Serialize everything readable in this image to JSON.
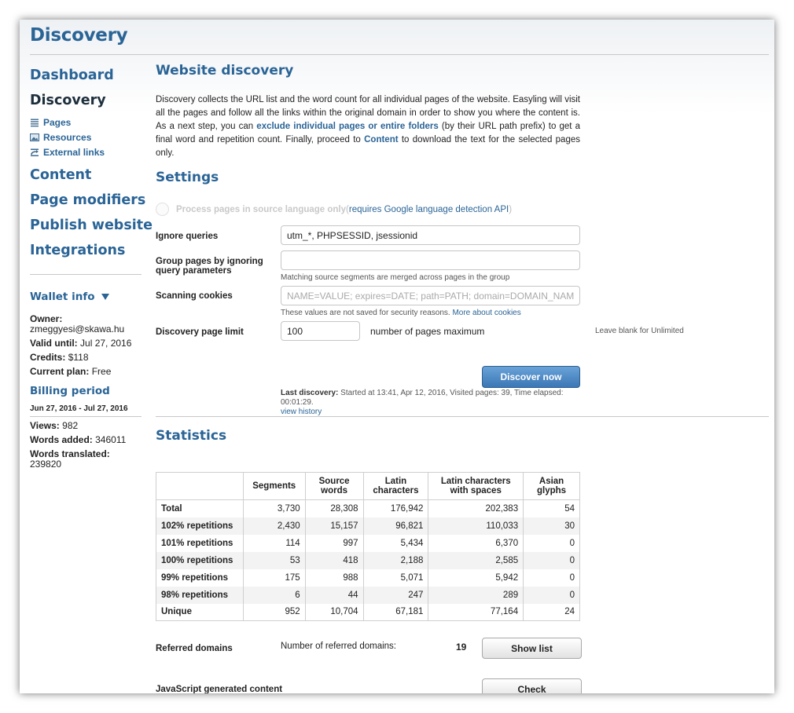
{
  "app": {
    "title": "Discovery"
  },
  "sidebar": {
    "nav": [
      {
        "label": "Dashboard"
      },
      {
        "label": "Discovery"
      }
    ],
    "subnav": [
      {
        "label": "Pages",
        "icon": "list-icon"
      },
      {
        "label": "Resources",
        "icon": "image-icon"
      },
      {
        "label": "External links",
        "icon": "link-icon"
      }
    ],
    "nav2": [
      {
        "label": "Content"
      },
      {
        "label": "Page modifiers"
      },
      {
        "label": "Publish website"
      },
      {
        "label": "Integrations"
      }
    ],
    "wallet": {
      "title": "Wallet info",
      "owner_label": "Owner:",
      "owner_value": "zmeggyesi@skawa.hu",
      "valid_label": "Valid until:",
      "valid_value": "Jul 27, 2016",
      "credits_label": "Credits:",
      "credits_value": "$118",
      "plan_label": "Current plan:",
      "plan_value": "Free"
    },
    "billing": {
      "title": "Billing period",
      "dates": "Jun 27, 2016 - Jul 27, 2016",
      "views_label": "Views:",
      "views_value": "982",
      "words_added_label": "Words added:",
      "words_added_value": "346011",
      "words_translated_label": "Words translated:",
      "words_translated_value": "239820"
    }
  },
  "main": {
    "title": "Website discovery",
    "intro": {
      "p1": "Discovery collects the URL list and the word count for all individual pages of the website. Easyling will visit all the pages and follow all the links within the original domain in order to show you where the content is. As a next step, you can ",
      "link1": "exclude individual pages or entire folders",
      "p2": " (by their URL path prefix) to get a final word and repetition count. Finally, proceed to ",
      "link2": "Content",
      "p3": " to download the text for the selected pages only."
    },
    "settings": {
      "title": "Settings",
      "process_label": "Process pages in source language only",
      "process_paren_open": " (",
      "process_link": "requires Google language detection API",
      "process_paren_close": ")",
      "ignore_queries_label": "Ignore queries",
      "ignore_queries_value": "utm_*, PHPSESSID, jsessionid",
      "group_label_1": "Group pages by ignoring",
      "group_label_2": "query parameters",
      "group_value": "",
      "group_hint": "Matching source segments are merged across pages in the group",
      "cookies_label": "Scanning cookies",
      "cookies_placeholder": "NAME=VALUE; expires=DATE; path=PATH; domain=DOMAIN_NAME; secure",
      "cookies_hint": "These values are not saved for security reasons. ",
      "cookies_hint_link": "More about cookies",
      "limit_label": "Discovery page limit",
      "limit_value": "100",
      "limit_suffix": "number of pages maximum",
      "limit_note": "Leave blank for Unlimited",
      "discover_button": "Discover now",
      "last_discovery_label": "Last discovery:",
      "last_discovery_text": " Started at 13:41, Apr 12, 2016, Visited pages: 39, Time elapsed: 00:01:29.",
      "view_history": "view history"
    },
    "statistics": {
      "title": "Statistics",
      "headers": [
        "",
        "Segments",
        "Source words",
        "Latin characters",
        "Latin characters with spaces",
        "Asian glyphs"
      ],
      "rows": [
        [
          "Total",
          "3,730",
          "28,308",
          "176,942",
          "202,383",
          "54"
        ],
        [
          "102% repetitions",
          "2,430",
          "15,157",
          "96,821",
          "110,033",
          "30"
        ],
        [
          "101% repetitions",
          "114",
          "997",
          "5,434",
          "6,370",
          "0"
        ],
        [
          "100% repetitions",
          "53",
          "418",
          "2,188",
          "2,585",
          "0"
        ],
        [
          "99% repetitions",
          "175",
          "988",
          "5,071",
          "5,942",
          "0"
        ],
        [
          "98% repetitions",
          "6",
          "44",
          "247",
          "289",
          "0"
        ],
        [
          "Unique",
          "952",
          "10,704",
          "67,181",
          "77,164",
          "24"
        ]
      ]
    },
    "referred": {
      "label": "Referred domains",
      "count_label": "Number of referred domains:",
      "count_value": "19",
      "button": "Show list"
    },
    "javascript": {
      "label": "JavaScript generated content",
      "button": "Check"
    }
  }
}
